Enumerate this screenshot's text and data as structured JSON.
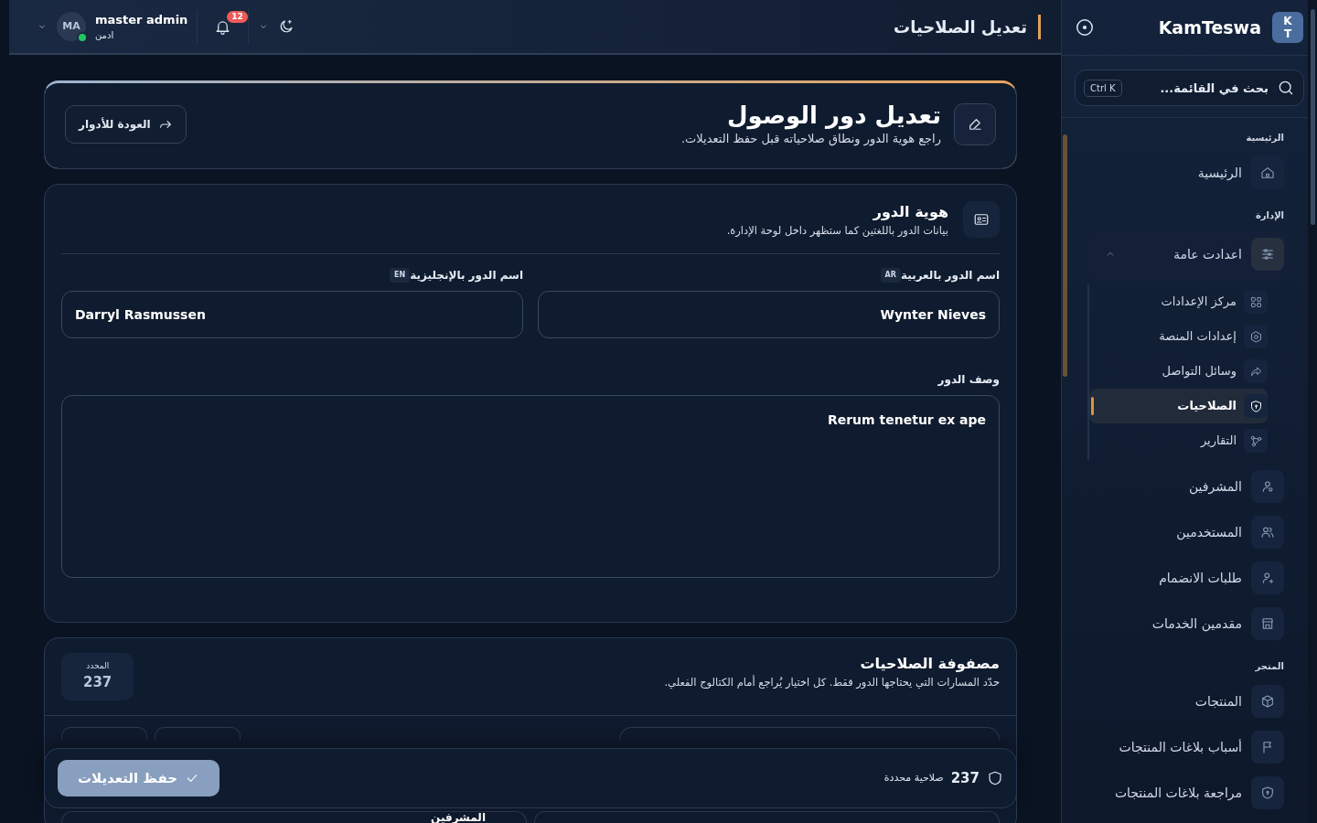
{
  "sidebar": {
    "logo_letters": [
      "K",
      "T"
    ],
    "brand": "KamTeswa",
    "search": {
      "placeholder": "بحث في القائمة...",
      "shortcut": "Ctrl K"
    },
    "sections": [
      {
        "title": "الرئيسية",
        "items": [
          {
            "label": "الرئيسية",
            "kind": "home",
            "selected": false
          }
        ]
      },
      {
        "title": "الإدارة",
        "items": [
          {
            "label": "اعدادت عامة",
            "kind": "sliders",
            "selected": false,
            "expanded": true,
            "children": [
              {
                "label": "مركز الإعدادات",
                "kind": "grid",
                "selected": false
              },
              {
                "label": "إعدادات المنصة",
                "kind": "hexagon",
                "selected": false
              },
              {
                "label": "وسائل التواصل",
                "kind": "share",
                "selected": false
              },
              {
                "label": "الصلاحيات",
                "kind": "shield",
                "selected": true
              },
              {
                "label": "التقارير",
                "kind": "nodes",
                "selected": false
              }
            ]
          },
          {
            "label": "المشرفين",
            "kind": "user",
            "selected": false
          },
          {
            "label": "المستخدمين",
            "kind": "users",
            "selected": false
          },
          {
            "label": "طلبات الانضمام",
            "kind": "userplus",
            "selected": false
          },
          {
            "label": "مقدمين الخدمات",
            "kind": "store",
            "selected": false
          }
        ]
      },
      {
        "title": "المتجر",
        "items": [
          {
            "label": "المنتجات",
            "kind": "box",
            "selected": false
          },
          {
            "label": "أسباب بلاغات المنتجات",
            "kind": "flag",
            "selected": false
          },
          {
            "label": "مراجعة بلاغات المنتجات",
            "kind": "shield",
            "selected": false
          }
        ]
      }
    ]
  },
  "header": {
    "title": "تعديل الصلاحيات",
    "user": {
      "name": "master admin",
      "role": "ادمن",
      "initials": "MA",
      "online": true
    },
    "notifications": "12"
  },
  "hero": {
    "title": "تعديل دور الوصول",
    "subtitle": "راجع هوية الدور ونطاق صلاحياته قبل حفظ التعديلات.",
    "back_button": "العودة للأدوار"
  },
  "identity": {
    "title": "هوية الدور",
    "subtitle": "بيانات الدور باللغتين كما ستظهر داخل لوحة الإدارة.",
    "fields": [
      {
        "label": "اسم الدور بالعربية",
        "lang": "AR",
        "value": "Wynter Nieves"
      },
      {
        "label": "اسم الدور بالإنجليزية",
        "lang": "EN",
        "value": "Darryl Rasmussen"
      }
    ],
    "description": {
      "label": "وصف الدور",
      "value": "Rerum tenetur ex ape"
    }
  },
  "matrix": {
    "title": "مصفوفة الصلاحيات",
    "subtitle": "حدّد المسارات التي يحتاجها الدور فقط. كل اختيار يُراجع أمام الكتالوج الفعلي.",
    "counter_label": "المحدد",
    "counter_value": "237",
    "group_title": "المشرفين"
  },
  "save_bar": {
    "count": "237",
    "count_label": "صلاحية محددة",
    "save_button": "حفظ التعديلات",
    "disabled": true
  }
}
